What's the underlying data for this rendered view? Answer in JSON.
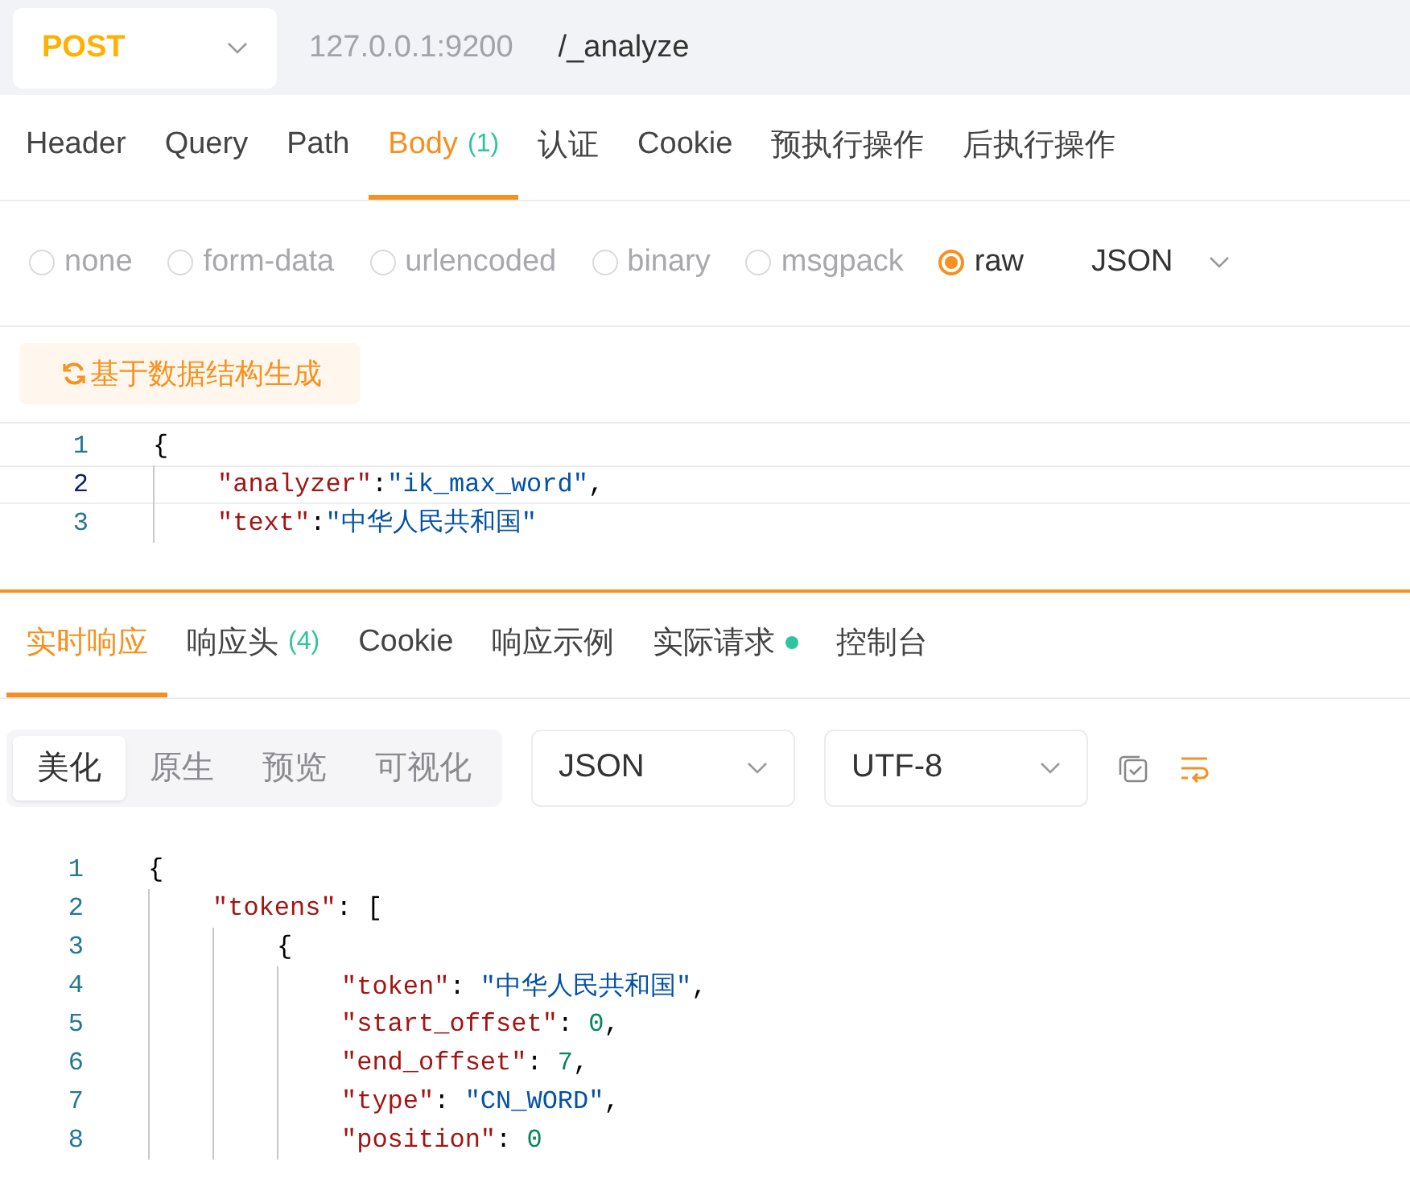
{
  "request": {
    "method": "POST",
    "host": "127.0.0.1:9200",
    "path": "/_analyze"
  },
  "request_tabs": [
    {
      "label": "Header",
      "selected": false
    },
    {
      "label": "Query",
      "selected": false
    },
    {
      "label": "Path",
      "selected": false
    },
    {
      "label": "Body",
      "count": "(1)",
      "selected": true
    },
    {
      "label": "认证",
      "selected": false
    },
    {
      "label": "Cookie",
      "selected": false
    },
    {
      "label": "预执行操作",
      "selected": false
    },
    {
      "label": "后执行操作",
      "selected": false
    }
  ],
  "body_types": [
    {
      "label": "none",
      "selected": false
    },
    {
      "label": "form-data",
      "selected": false
    },
    {
      "label": "urlencoded",
      "selected": false
    },
    {
      "label": "binary",
      "selected": false
    },
    {
      "label": "msgpack",
      "selected": false
    },
    {
      "label": "raw",
      "selected": true
    }
  ],
  "body_format": "JSON",
  "generate_button": "基于数据结构生成",
  "body_code": [
    {
      "number": "1",
      "active": false,
      "tokens": [
        {
          "kind": "punct",
          "text": "{"
        }
      ],
      "children": [
        {
          "number": "2",
          "active": true,
          "tokens": [
            {
              "kind": "key",
              "text": "\"analyzer\""
            },
            {
              "kind": "punct",
              "text": ":"
            },
            {
              "kind": "string",
              "text": "\"ik_max_word\""
            },
            {
              "kind": "punct",
              "text": ","
            }
          ]
        },
        {
          "number": "3",
          "active": false,
          "tokens": [
            {
              "kind": "key",
              "text": "\"text\""
            },
            {
              "kind": "punct",
              "text": ":"
            },
            {
              "kind": "string",
              "text": "\"中华人民共和国\""
            }
          ]
        }
      ]
    }
  ],
  "response_tabs": [
    {
      "label": "实时响应",
      "selected": true
    },
    {
      "label": "响应头",
      "count": "(4)",
      "selected": false
    },
    {
      "label": "Cookie",
      "selected": false
    },
    {
      "label": "响应示例",
      "selected": false
    },
    {
      "label": "实际请求",
      "dot": true,
      "selected": false
    },
    {
      "label": "控制台",
      "selected": false
    }
  ],
  "view_modes": [
    {
      "label": "美化",
      "selected": true
    },
    {
      "label": "原生",
      "selected": false
    },
    {
      "label": "预览",
      "selected": false
    },
    {
      "label": "可视化",
      "selected": false
    }
  ],
  "response_format": "JSON",
  "encoding": "UTF-8",
  "response_code": [
    {
      "number": "1",
      "active": false,
      "tokens": [
        {
          "kind": "punct",
          "text": "{"
        }
      ],
      "children": [
        {
          "number": "2",
          "active": false,
          "tokens": [
            {
              "kind": "key",
              "text": "\"tokens\""
            },
            {
              "kind": "punct",
              "text": ": ["
            }
          ],
          "children": [
            {
              "number": "3",
              "active": false,
              "tokens": [
                {
                  "kind": "punct",
                  "text": "{"
                }
              ],
              "children": [
                {
                  "number": "4",
                  "active": false,
                  "tokens": [
                    {
                      "kind": "key",
                      "text": "\"token\""
                    },
                    {
                      "kind": "punct",
                      "text": ": "
                    },
                    {
                      "kind": "string",
                      "text": "\"中华人民共和国\""
                    },
                    {
                      "kind": "punct",
                      "text": ","
                    }
                  ]
                },
                {
                  "number": "5",
                  "active": false,
                  "tokens": [
                    {
                      "kind": "key",
                      "text": "\"start_offset\""
                    },
                    {
                      "kind": "punct",
                      "text": ": "
                    },
                    {
                      "kind": "number",
                      "text": "0"
                    },
                    {
                      "kind": "punct",
                      "text": ","
                    }
                  ]
                },
                {
                  "number": "6",
                  "active": false,
                  "tokens": [
                    {
                      "kind": "key",
                      "text": "\"end_offset\""
                    },
                    {
                      "kind": "punct",
                      "text": ": "
                    },
                    {
                      "kind": "number",
                      "text": "7"
                    },
                    {
                      "kind": "punct",
                      "text": ","
                    }
                  ]
                },
                {
                  "number": "7",
                  "active": false,
                  "tokens": [
                    {
                      "kind": "key",
                      "text": "\"type\""
                    },
                    {
                      "kind": "punct",
                      "text": ": "
                    },
                    {
                      "kind": "string",
                      "text": "\"CN_WORD\""
                    },
                    {
                      "kind": "punct",
                      "text": ","
                    }
                  ]
                },
                {
                  "number": "8",
                  "active": false,
                  "tokens": [
                    {
                      "kind": "key",
                      "text": "\"position\""
                    },
                    {
                      "kind": "punct",
                      "text": ": "
                    },
                    {
                      "kind": "number",
                      "text": "0"
                    }
                  ]
                }
              ]
            }
          ]
        }
      ]
    }
  ]
}
